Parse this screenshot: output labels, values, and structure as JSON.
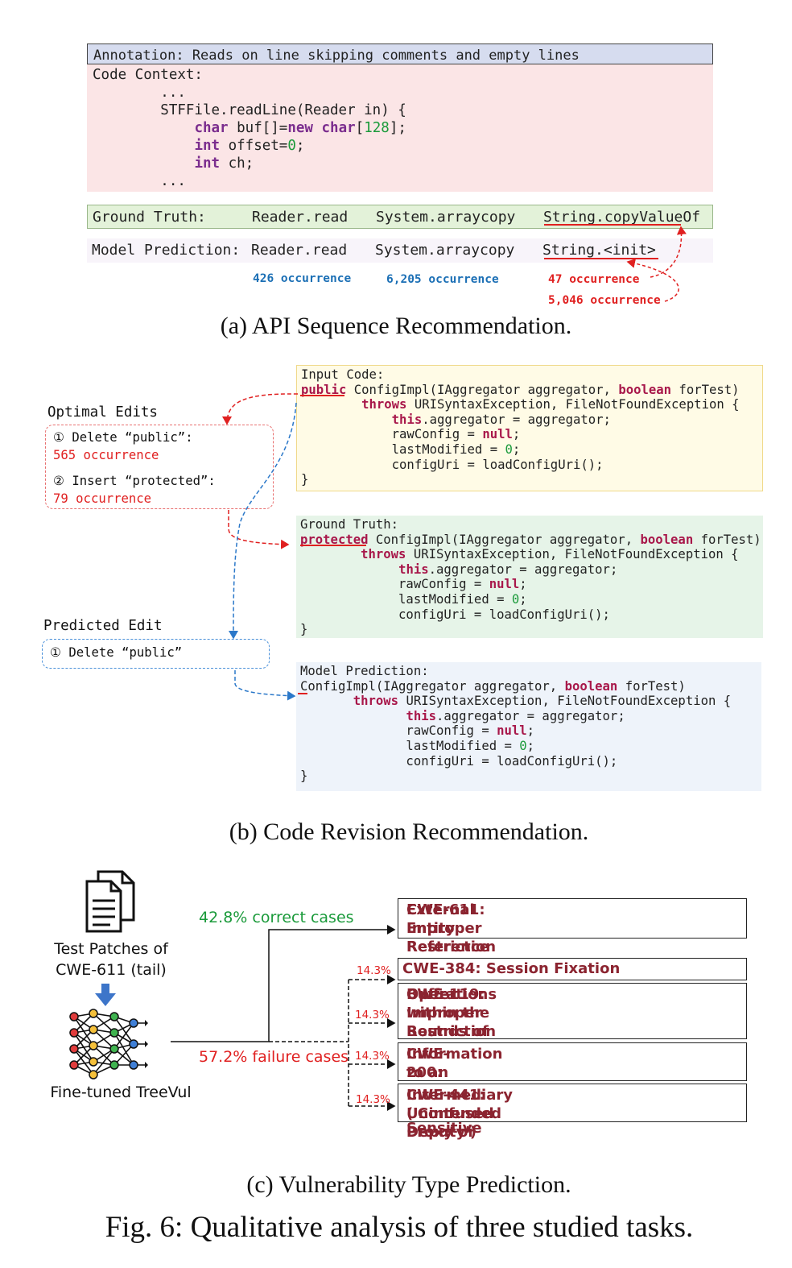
{
  "panel_a": {
    "annotation": "Annotation: Reads on line skipping comments and empty lines",
    "code_context_label": "Code Context:",
    "code_lines": [
      "        ...",
      "        STFFile.readLine(Reader in) {",
      "            char buf[]=new char[128];",
      "            int offset=0;",
      "            int ch;",
      "        ..."
    ],
    "ground_truth_label": "Ground Truth:",
    "model_prediction_label": "Model Prediction:",
    "gt_apis": [
      "Reader.read",
      "System.arraycopy",
      "String.copyValueOf"
    ],
    "pred_apis": [
      "Reader.read",
      "System.arraycopy",
      "String.<init>"
    ],
    "occurrences": [
      "426 occurrence",
      "6,205 occurrence",
      "47 occurrence",
      "5,046 occurrence"
    ],
    "caption": "(a) API Sequence Recommendation."
  },
  "panel_b": {
    "optimal_title": "Optimal Edits",
    "optimal_edit1": "① Delete “public”:",
    "optimal_edit1_occ": "565 occurrence",
    "optimal_edit2": "② Insert “protected”:",
    "optimal_edit2_occ": "79 occurrence",
    "predicted_title": "Predicted Edit",
    "predicted_edit1": "① Delete “public”",
    "input_label": "Input Code:",
    "gt_label": "Ground Truth:",
    "pred_label": "Model Prediction:",
    "modifier_input": "public",
    "modifier_gt": "protected",
    "signature_rest": " ConfigImpl(IAggregator aggregator, boolean forTest)",
    "throws_line": "throws URISyntaxException, FileNotFoundException {",
    "body_lines": [
      "this.aggregator = aggregator;",
      "rawConfig = null;",
      "lastModified = 0;",
      "configUri = loadConfigUri();"
    ],
    "closing": "}",
    "caption": "(b) Code Revision Recommendation."
  },
  "panel_c": {
    "input_label_line1": "Test Patches of",
    "input_label_line2": "CWE-611 (tail)",
    "model_label": "Fine-tuned TreeVul",
    "correct_label": "42.8% correct cases",
    "failure_label": "57.2% failure cases",
    "cwe_boxes": [
      {
        "lines": [
          "CWE-611: Improper Restriction of XML",
          "External Entity Reference"
        ]
      },
      {
        "lines": [
          "CWE-384: Session Fixation"
        ],
        "pct": "14.3%"
      },
      {
        "lines": [
          "CWE-119: Improper Restriction of",
          "Operations within the Bounds of a Memory",
          "Buffer"
        ],
        "pct": "14.3%"
      },
      {
        "lines": [
          "CWE-200: Exposure of Sensitive",
          "Information to an Unauthorized Actor"
        ],
        "pct": "14.3%"
      },
      {
        "lines": [
          "CWE-441: Unintended Proxy or",
          "Intermediary ('Confused Deputy')"
        ],
        "pct": "14.3%"
      }
    ],
    "caption": "(c) Vulnerability Type Prediction."
  },
  "figure_caption": "Fig. 6: Qualitative analysis of three studied tasks."
}
